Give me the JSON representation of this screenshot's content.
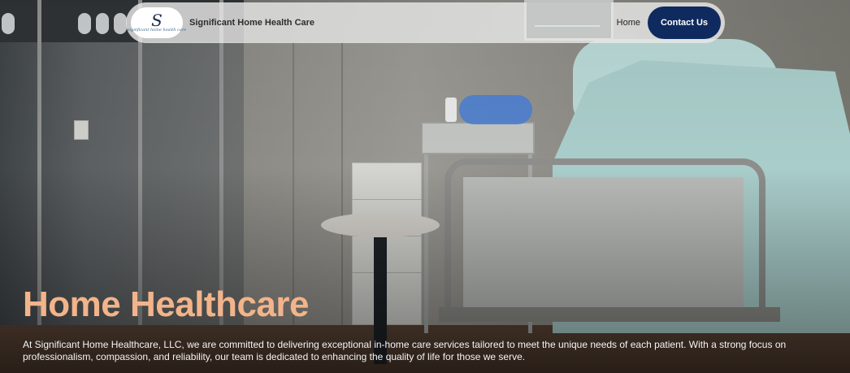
{
  "navbar": {
    "logo_letter": "S",
    "logo_text": "significant home health care",
    "brand": "Significant Home Health Care",
    "home_link": "Home",
    "contact_button": "Contact Us"
  },
  "hero": {
    "title": "Home Healthcare",
    "description": "At Significant Home Healthcare, LLC, we are committed to delivering exceptional in-home care services tailored to meet the unique needs of each patient. With a strong focus on professionalism, compassion, and reliability, our team is dedicated to enhancing the quality of life for those we serve."
  },
  "colors": {
    "accent_title": "#f2b48a",
    "contact_button_bg": "#0f2a5e",
    "navbar_bg": "#e8e8e6"
  }
}
